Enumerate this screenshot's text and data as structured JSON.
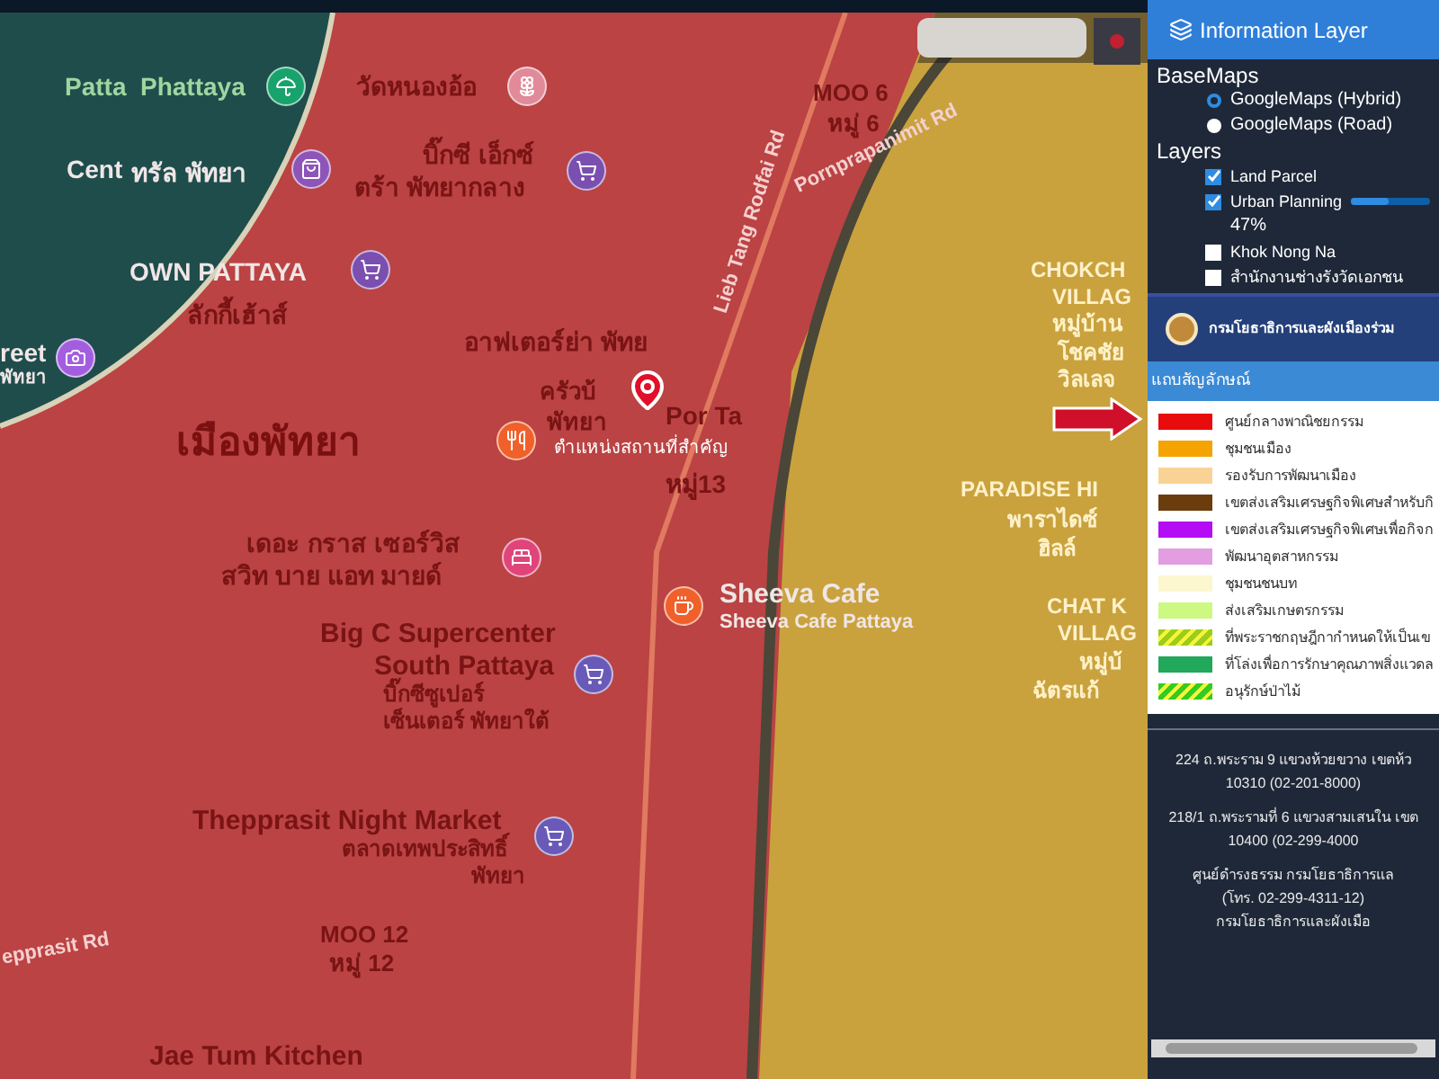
{
  "map": {
    "labels": [
      {
        "text": "Patta",
        "kind": "sea"
      },
      {
        "text": "Phattaya",
        "kind": "sea"
      },
      {
        "text": "Cent",
        "kind": "light"
      },
      {
        "text": "ทรัล พัทยา",
        "kind": "light"
      },
      {
        "text": "OWN PATTAYA",
        "kind": "light"
      },
      {
        "text": "ลักกี้เฮ้าส์",
        "kind": "place"
      },
      {
        "text": "reet",
        "kind": "light"
      },
      {
        "text": "พัทยา",
        "kind": "light"
      },
      {
        "text": "วัดหนองอ้อ",
        "kind": "place"
      },
      {
        "text": "บิ๊กซี เอ็กซ์",
        "kind": "place"
      },
      {
        "text": "ตร้า พัทยากลาง",
        "kind": "place"
      },
      {
        "text": "อาฟเตอร์ย่า พัทย",
        "kind": "place"
      },
      {
        "text": "เมืองพัทยา",
        "kind": "city"
      },
      {
        "text": "ครัวบ้",
        "kind": "place"
      },
      {
        "text": "พัทยา",
        "kind": "place"
      },
      {
        "text": "Por Ta",
        "kind": "place"
      },
      {
        "text": "ตำแหน่งสถานที่สำคัญ",
        "kind": "marker"
      },
      {
        "text": "หมู่13",
        "kind": "place"
      },
      {
        "text": "เดอะ กราส เซอร์วิส",
        "kind": "place"
      },
      {
        "text": "สวิท บาย แอท มายด์",
        "kind": "place"
      },
      {
        "text": "Sheeva Cafe",
        "kind": "light"
      },
      {
        "text": "Sheeva Cafe Pattaya",
        "kind": "light"
      },
      {
        "text": "Big C Supercenter",
        "kind": "place"
      },
      {
        "text": "South Pattaya",
        "kind": "place"
      },
      {
        "text": "บิ๊กซีซูเปอร์",
        "kind": "place"
      },
      {
        "text": "เซ็นเตอร์ พัทยาใต้",
        "kind": "place"
      },
      {
        "text": "Thepprasit Night Market",
        "kind": "place"
      },
      {
        "text": "ตลาดเทพประสิทธิ์",
        "kind": "place"
      },
      {
        "text": "พัทยา",
        "kind": "place"
      },
      {
        "text": "MOO 12",
        "kind": "place"
      },
      {
        "text": "หมู่ 12",
        "kind": "place"
      },
      {
        "text": "epprasit Rd",
        "kind": "road"
      },
      {
        "text": "Jae Tum Kitchen",
        "kind": "place"
      },
      {
        "text": "MOO 6",
        "kind": "place"
      },
      {
        "text": "หมู่ 6",
        "kind": "place"
      },
      {
        "text": "Pornprapanimit Rd",
        "kind": "road"
      },
      {
        "text": "Lieb Tang Rodfai Rd",
        "kind": "road"
      },
      {
        "text": "CHOKCH",
        "kind": "village"
      },
      {
        "text": "VILLAG",
        "kind": "village"
      },
      {
        "text": "หมู่บ้าน",
        "kind": "village"
      },
      {
        "text": "โชคชัย",
        "kind": "village"
      },
      {
        "text": "วิลเลจ",
        "kind": "village"
      },
      {
        "text": "PARADISE HI",
        "kind": "village"
      },
      {
        "text": "พาราไดซ์",
        "kind": "village"
      },
      {
        "text": "ฮิลล์",
        "kind": "village"
      },
      {
        "text": "CHAT K",
        "kind": "village"
      },
      {
        "text": "VILLAG",
        "kind": "village"
      },
      {
        "text": "หมู่บ้",
        "kind": "village"
      },
      {
        "text": "ฉัตรแก้",
        "kind": "village"
      }
    ]
  },
  "panel": {
    "title": "Information Layer",
    "basemaps": {
      "heading": "BaseMaps",
      "options": [
        {
          "label": "GoogleMaps (Hybrid)",
          "selected": true
        },
        {
          "label": "GoogleMaps (Road)",
          "selected": false
        }
      ]
    },
    "layers": {
      "heading": "Layers",
      "items": [
        {
          "label": "Land Parcel",
          "checked": true
        },
        {
          "label": "Urban Planning",
          "checked": true,
          "level": 0.47,
          "reading": "47%"
        },
        {
          "label": "Khok Nong Na",
          "checked": false
        },
        {
          "label": "สำนักงานช่างรังวัดเอกชน",
          "checked": false
        }
      ]
    },
    "department": "กรมโยธาธิการและผังเมืองร่วม",
    "legend": {
      "title": "แถบสัญลักษณ์",
      "items": [
        {
          "label": "ศูนย์กลางพาณิชยกรรม",
          "kind": "solid",
          "color": "#e80c0c"
        },
        {
          "label": "ชุมชนเมือง",
          "kind": "solid",
          "color": "#f5a300"
        },
        {
          "label": "รองรับการพัฒนาเมือง",
          "kind": "solid",
          "color": "#f9d396"
        },
        {
          "label": "เขตส่งเสริมเศรษฐกิจพิเศษสำหรับกิ",
          "kind": "solid",
          "color": "#6b3d0c"
        },
        {
          "label": "เขตส่งเสริมเศรษฐกิจพิเศษเพื่อกิจก",
          "kind": "solid",
          "color": "#b40cf5"
        },
        {
          "label": "พัฒนาอุตสาหกรรม",
          "kind": "solid",
          "color": "#e29ee0"
        },
        {
          "label": "ชุมชนชนบท",
          "kind": "solid",
          "color": "#fdf7cf"
        },
        {
          "label": "ส่งเสริมเกษตรกรรม",
          "kind": "solid",
          "color": "#cdf882"
        },
        {
          "label": "ที่พระราชกฤษฎีกากำหนดให้เป็นเข",
          "kind": "hatched",
          "color": "#9ccc1c"
        },
        {
          "label": "ที่โล่งเพื่อการรักษาคุณภาพสิ่งแวดล",
          "kind": "solid",
          "color": "#22a85a"
        },
        {
          "label": "อนุรักษ์ป่าไม้",
          "kind": "hatched",
          "color": "#33cc22"
        }
      ]
    },
    "addresses": [
      {
        "lines": [
          "224 ถ.พระราม 9 แขวงห้วยขวาง เขตห้ว",
          "10310 (02-201-8000)"
        ]
      },
      {
        "lines": [
          "218/1 ถ.พระรามที่ 6 แขวงสามเสนใน เขต",
          "10400 (02-299-4000"
        ]
      },
      {
        "lines": [
          "ศูนย์ดำรงธรรม กรมโยธาธิการแล",
          "(โทร. 02-299-4311-12)",
          "กรมโยธาธิการและผังเมือ"
        ]
      }
    ]
  }
}
